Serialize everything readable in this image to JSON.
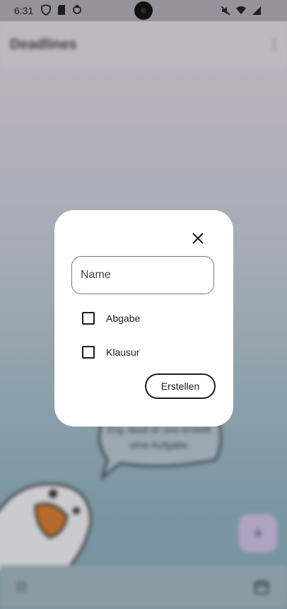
{
  "status_bar": {
    "time": "6:31",
    "left_icons": [
      "shield-icon",
      "sd-card-icon",
      "sync-icon"
    ],
    "right_icons": [
      "mute-icon",
      "wifi-icon",
      "signal-icon"
    ]
  },
  "app": {
    "title": "Deadlines",
    "speech_bubble": "Erg, lässt ör uns erstellt eine Aufgabe"
  },
  "dialog": {
    "name_placeholder": "Name",
    "name_value": "",
    "checkboxes": [
      {
        "label": "Abgabe",
        "checked": false
      },
      {
        "label": "Klausur",
        "checked": false
      }
    ],
    "create_label": "Erstellen"
  },
  "colors": {
    "dialog_bg": "#ffffff",
    "fab": "#d8c8ee",
    "accent": "#1c1b1f"
  }
}
